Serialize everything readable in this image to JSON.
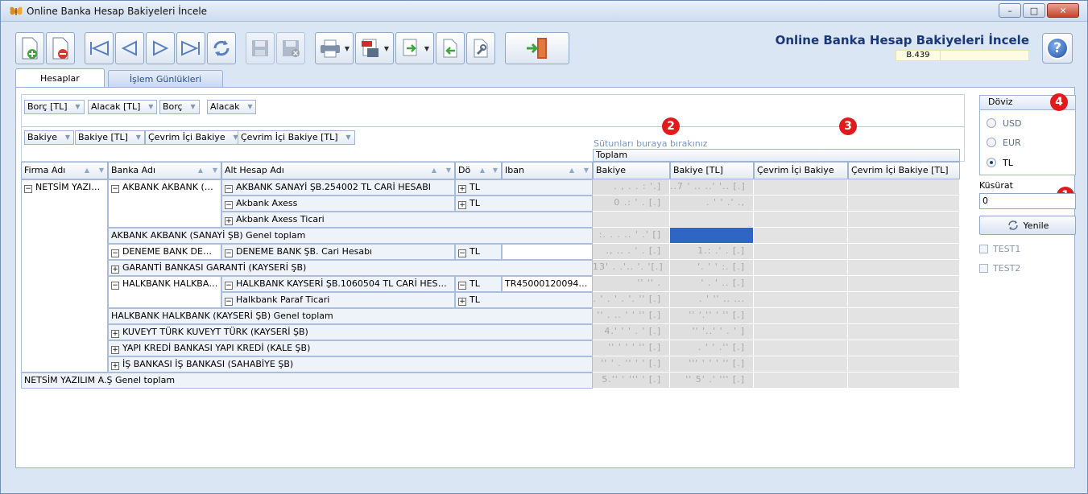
{
  "window": {
    "title": "Online Banka Hesap Bakiyeleri İncele",
    "buttons": {
      "minimize": "–",
      "maximize": "□",
      "close": "✕"
    }
  },
  "header": {
    "title": "Online Banka Hesap Bakiyeleri İncele",
    "code": "B.439",
    "help": "?"
  },
  "tabs": [
    {
      "label": "Hesaplar",
      "active": true
    },
    {
      "label": "İşlem Günlükleri",
      "active": false
    }
  ],
  "group_chips_row1": [
    "Borç [TL]",
    "Alacak [TL]",
    "Borç",
    "Alacak"
  ],
  "group_chips_row2": [
    "Bakiye",
    "Bakiye [TL]",
    "Çevrim İçi Bakiye",
    "Çevrim İçi Bakiye [TL]"
  ],
  "drop_hint": "Sütunları buraya bırakınız",
  "callouts": [
    "1",
    "2",
    "3",
    "4"
  ],
  "grid": {
    "columns": [
      "Firma Adı",
      "Banka Adı",
      "Alt Hesap Adı",
      "Döviz",
      "Iban"
    ],
    "column_short": {
      "doviz": "Dö"
    },
    "total_group": "Toplam",
    "value_columns": [
      "Bakiye",
      "Bakiye [TL]",
      "Çevrim İçi Bakiye",
      "Çevrim İçi Bakiye [TL]"
    ],
    "firma": "NETSİM YAZILI...",
    "banks": {
      "akbank": "AKBANK AKBANK (SA...",
      "deneme": "DENEME BANK DENE...",
      "garanti": "GARANTİ BANKASI GARANTİ (KAYSERİ ŞB)",
      "halkbank": "HALKBANK HALKBANK...",
      "kuveyt": "KUVEYT TÜRK KUVEYT TÜRK (KAYSERİ ŞB)",
      "yapikredi": "YAPI KREDİ BANKASI YAPI KREDİ (KALE ŞB)",
      "isbank": "İŞ BANKASI İŞ BANKASI (SAHABİYE ŞB)"
    },
    "accounts": {
      "a1": "AKBANK SANAYİ ŞB.254002 TL CARİ HESABI",
      "a2": "Akbank Axess",
      "a3": "Akbank Axess Ticari",
      "d1": "DENEME BANK ŞB. Cari Hesabı",
      "h1": "HALKBANK KAYSERİ ŞB.1060504 TL CARİ HESABI",
      "h2": "Halkbank Paraf Ticari"
    },
    "currency": {
      "tl": "TL"
    },
    "iban": "TR4500012009492...",
    "totals": {
      "akbank": "AKBANK AKBANK (SANAYİ ŞB) Genel toplam",
      "halkbank": "HALKBANK HALKBANK (KAYSERİ ŞB) Genel toplam",
      "firma": "NETSİM YAZILIM A.Ş Genel toplam"
    },
    "blurred": {
      "r1b": ". , . . :  '.]",
      "r1t": "..7 ' .. ..' '.. [.]",
      "r2b": "0 .: ' . [.]",
      "r2t": ". '   ' .' .,",
      "r4b": ":. . . .. ' .' []",
      "r4t": "",
      "r5b": "., .. . ' . [.]",
      "r5t": "1.:   .' . [.]",
      "r6b": "13' . .'.. '. '[.]",
      "r6t": "'. ' ' :. [.]",
      "r7b": "'' ''  .",
      "r7t": "' . ' .. [.]",
      "r8b": ". ' . ' . '. '' [.]",
      "r8t": ". ' '' .. ...",
      "r9b": "'' . .. ' ' '' [.]",
      "r9t": "'' '.'' ' '' [.]",
      "r10b": "4.' ' '  . ' [.]",
      "r10t": "'' '..' ' . ' ]",
      "r11b": "'' ' ' ' '' [.]",
      "r11t": ". '  ' .'' [.]",
      "r12b": "'' ' . '' ' ' [.]",
      "r12t": "''' ' ' ' '' [.]",
      "r13b": "'' ' ' ' '' [.]",
      "r13t": "'' ' ' ' '' [.]",
      "r14b": "5.'' ' ''' ' [.]",
      "r14t": "'' 5' .' ''' [.]"
    }
  },
  "side": {
    "doviz_title": "Döviz",
    "options": [
      "USD",
      "EUR",
      "TL"
    ],
    "selected": "TL",
    "kusurat_label": "Küsürat",
    "kusurat_value": "0",
    "refresh": "Yenile",
    "checks": [
      "TEST1",
      "TEST2"
    ]
  }
}
